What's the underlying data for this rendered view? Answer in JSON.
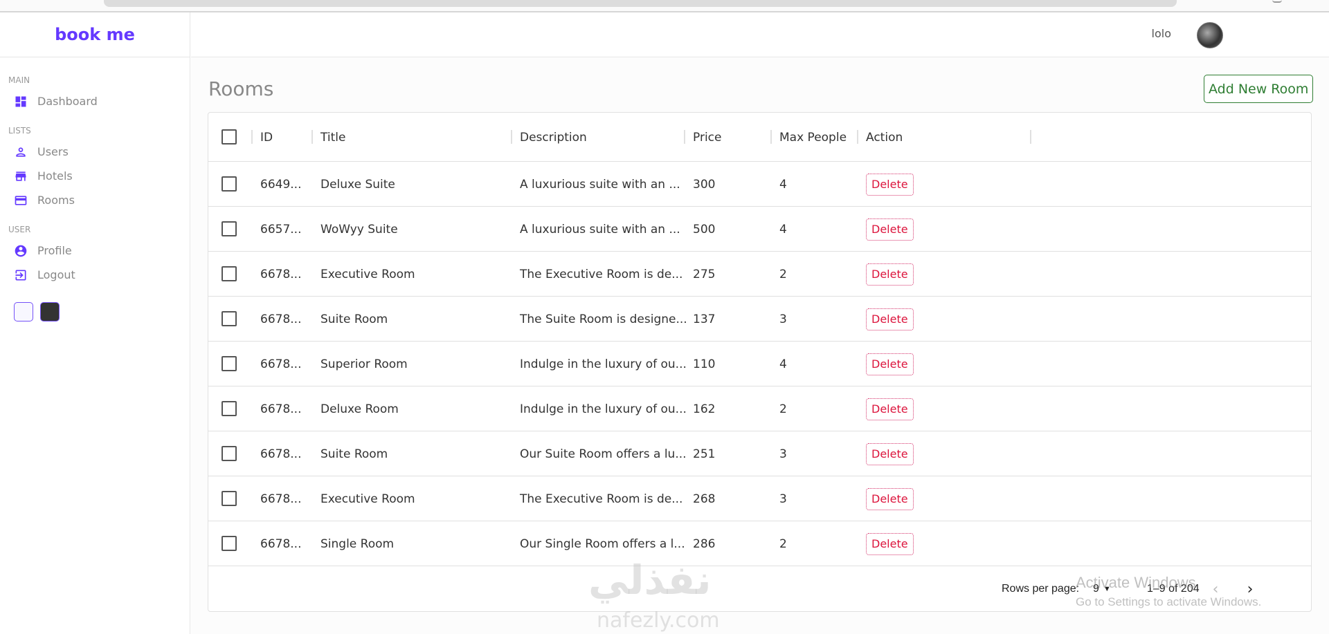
{
  "app": {
    "logo": "book me"
  },
  "navbar": {
    "user_name": "lolo"
  },
  "sidebar": {
    "sections": [
      {
        "title": "MAIN",
        "items": [
          {
            "label": "Dashboard",
            "icon": "dashboard-icon"
          }
        ]
      },
      {
        "title": "LISTS",
        "items": [
          {
            "label": "Users",
            "icon": "person-icon"
          },
          {
            "label": "Hotels",
            "icon": "store-icon"
          },
          {
            "label": "Rooms",
            "icon": "credit-card-icon"
          }
        ]
      },
      {
        "title": "USER",
        "items": [
          {
            "label": "Profile",
            "icon": "account-circle-icon"
          },
          {
            "label": "Logout",
            "icon": "exit-icon"
          }
        ]
      }
    ],
    "accent_color": "#6439ff"
  },
  "page": {
    "title": "Rooms",
    "add_button": "Add New Room"
  },
  "table": {
    "columns": [
      "ID",
      "Title",
      "Description",
      "Price",
      "Max People",
      "Action"
    ],
    "rows": [
      {
        "id": "6649...",
        "title": "Deluxe Suite",
        "description": "A luxurious suite with an ...",
        "price": "300",
        "max_people": "4",
        "action": "Delete"
      },
      {
        "id": "6657...",
        "title": "WoWyy Suite",
        "description": "A luxurious suite with an ...",
        "price": "500",
        "max_people": "4",
        "action": "Delete"
      },
      {
        "id": "6678...",
        "title": "Executive Room",
        "description": "The Executive Room is de...",
        "price": "275",
        "max_people": "2",
        "action": "Delete"
      },
      {
        "id": "6678...",
        "title": "Suite Room",
        "description": "The Suite Room is designe...",
        "price": "137",
        "max_people": "3",
        "action": "Delete"
      },
      {
        "id": "6678...",
        "title": "Superior Room",
        "description": "Indulge in the luxury of ou...",
        "price": "110",
        "max_people": "4",
        "action": "Delete"
      },
      {
        "id": "6678...",
        "title": "Deluxe Room",
        "description": "Indulge in the luxury of ou...",
        "price": "162",
        "max_people": "2",
        "action": "Delete"
      },
      {
        "id": "6678...",
        "title": "Suite Room",
        "description": "Our Suite Room offers a lu...",
        "price": "251",
        "max_people": "3",
        "action": "Delete"
      },
      {
        "id": "6678...",
        "title": "Executive Room",
        "description": "The Executive Room is de...",
        "price": "268",
        "max_people": "3",
        "action": "Delete"
      },
      {
        "id": "6678...",
        "title": "Single Room",
        "description": "Our Single Room offers a l...",
        "price": "286",
        "max_people": "2",
        "action": "Delete"
      }
    ]
  },
  "footer": {
    "rows_per_page_label": "Rows per page:",
    "rows_per_page_value": "9",
    "range_text": "1–9 of 204"
  },
  "overlays": {
    "activate_title": "Activate Windows",
    "activate_sub": "Go to Settings to activate Windows.",
    "brand_watermark": "نفذلي",
    "brand_url": "nafezly.com"
  }
}
